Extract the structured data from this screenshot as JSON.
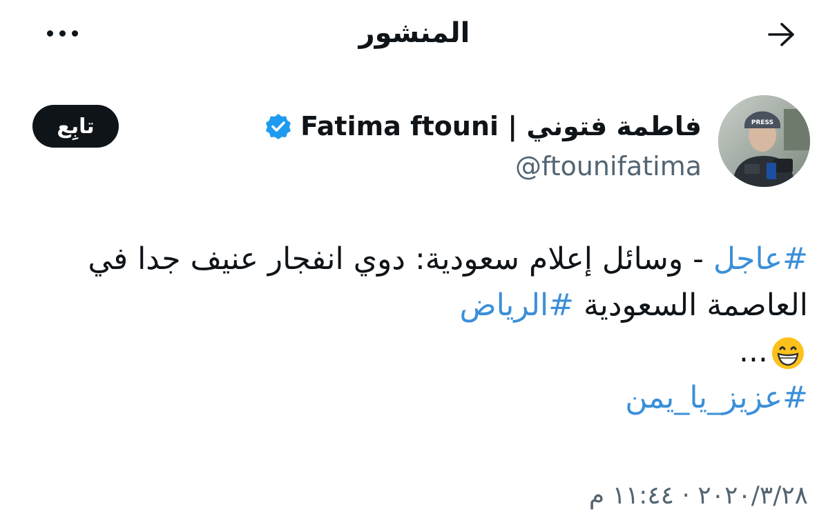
{
  "header": {
    "title": "المنشور",
    "back_icon": "arrow-right-icon",
    "more_icon": "more-horizontal-icon"
  },
  "author": {
    "display_name": "فاطمة فتوني | Fatima ftouni",
    "handle": "@ftounifatima",
    "verified": true,
    "verified_color": "#1d9bf0",
    "avatar_text": "PRESS",
    "follow_label": "تابِع"
  },
  "tweet": {
    "line1": {
      "hashtag": "#عاجل",
      "text": " - وسائل إعلام سعودية: دوي انفجار عنيف جدا في"
    },
    "line2": {
      "text": "العاصمة السعودية ",
      "hashtag": "#الرياض"
    },
    "line3": {
      "text": "...",
      "emoji": "grinning-face-emoji"
    },
    "line4": {
      "hashtag": "#عزيز_يا_يمن"
    },
    "hashtag_color": "#3b8fd9"
  },
  "meta": {
    "timestamp": "٢٠٢٠/٣/٢٨ · ١١:٤٤ م"
  }
}
